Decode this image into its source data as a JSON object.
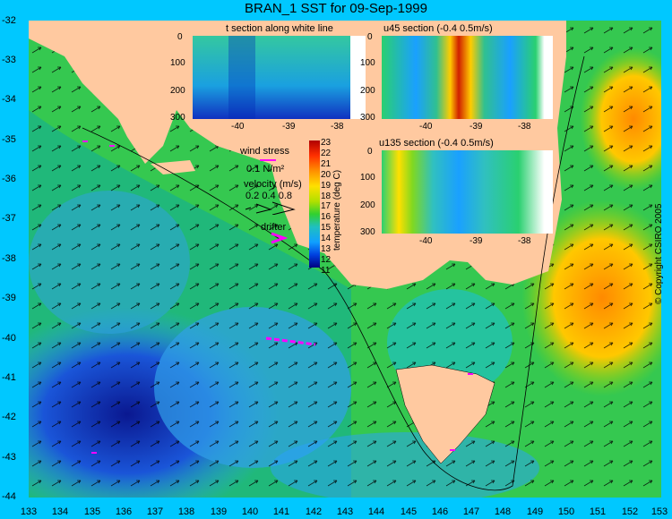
{
  "title": "BRAN_1 SST for 09-Sep-1999",
  "map": {
    "lat_labels": [
      "-32",
      "-33",
      "-34",
      "-35",
      "-36",
      "-37",
      "-38",
      "-39",
      "-40",
      "-41",
      "-42",
      "-43",
      "-44"
    ],
    "lon_labels": [
      "133",
      "134",
      "135",
      "136",
      "137",
      "138",
      "139",
      "140",
      "141",
      "142",
      "143",
      "144",
      "145",
      "146",
      "147",
      "148",
      "149",
      "150",
      "151",
      "152",
      "153"
    ]
  },
  "panels": {
    "t_section": {
      "title": "t section along white line",
      "y_ticks": [
        "0",
        "100",
        "200",
        "300"
      ],
      "x_ticks": [
        "-40",
        "-39",
        "-38"
      ]
    },
    "u45_section": {
      "title": "u45 section (-0.4     0.5m/s)",
      "y_ticks": [
        "0",
        "100",
        "200",
        "300"
      ],
      "x_ticks": [
        "-40",
        "-39",
        "-38"
      ]
    },
    "u135_section": {
      "title": "u135 section (-0.4     0.5m/s)",
      "y_ticks": [
        "0",
        "100",
        "200",
        "300"
      ],
      "x_ticks": [
        "-40",
        "-39",
        "-38"
      ]
    }
  },
  "legend": {
    "wind_stress": "wind stress",
    "wind_value": "0.1 N/m²",
    "velocity": "velocity (m/s)",
    "velocity_values": "0.2 0.4 0.8",
    "drifter": "drifter"
  },
  "colorbar": {
    "label": "temperature (deg C)",
    "ticks": [
      "23",
      "22",
      "21",
      "20",
      "19",
      "18",
      "17",
      "16",
      "15",
      "14",
      "13",
      "12",
      "11"
    ]
  },
  "copyright": "© Copyright CSIRO 2005",
  "colors": {
    "land": "#ffc9a0",
    "background": "#00c8ff",
    "drifter": "#ff00ff"
  }
}
